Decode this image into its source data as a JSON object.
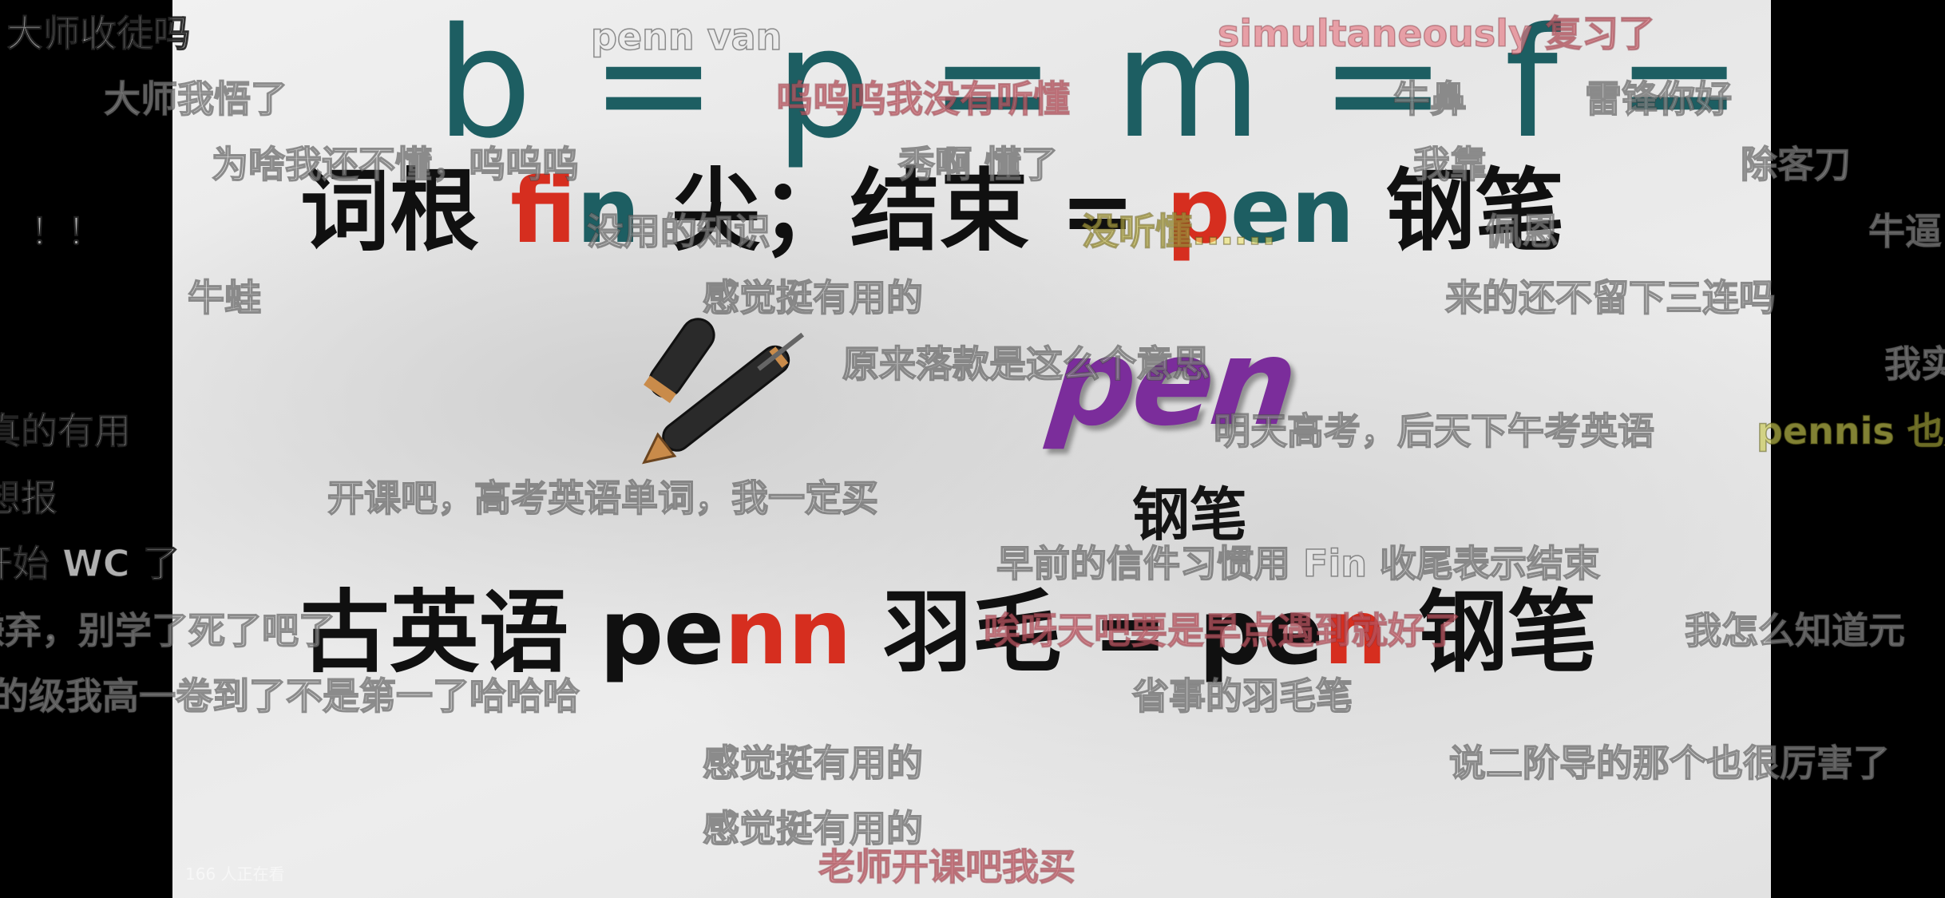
{
  "slide": {
    "formula": "b = p = m = f = v",
    "line2": {
      "prefix": "词根 ",
      "f": "f",
      "in": "in",
      "mid": " 尖；结束 = ",
      "p": "p",
      "en": "en",
      "suffix": " 钢笔"
    },
    "logo_text": "pen",
    "pen_caption": "钢笔",
    "line3": {
      "prefix": "古英语 pe",
      "nn": "nn",
      "mid": " 羽毛 = pe",
      "n": "n",
      "suffix": " 钢笔"
    }
  },
  "danmaku": [
    {
      "text": "大师收徒吗",
      "style": "dark"
    },
    {
      "text": "penn    van",
      "style": "normal"
    },
    {
      "text": "simultaneously 复习了",
      "style": "pink"
    },
    {
      "text": "大师我悟了",
      "style": "normal"
    },
    {
      "text": "呜呜呜我没有听懂",
      "style": "pink"
    },
    {
      "text": "牛鼻",
      "style": "normal"
    },
    {
      "text": "雷锋你好",
      "style": "normal"
    },
    {
      "text": "为啥我还不懂，呜呜呜",
      "style": "normal"
    },
    {
      "text": "秀啊 懂了",
      "style": "normal"
    },
    {
      "text": "我靠",
      "style": "normal"
    },
    {
      "text": "除客刀",
      "style": "normal"
    },
    {
      "text": "！！",
      "style": "dark"
    },
    {
      "text": "没用的知识",
      "style": "normal"
    },
    {
      "text": "没听懂......",
      "style": "yellow"
    },
    {
      "text": "佩恩",
      "style": "normal"
    },
    {
      "text": "牛逼",
      "style": "normal"
    },
    {
      "text": "牛蛙",
      "style": "normal"
    },
    {
      "text": "感觉挺有用的",
      "style": "normal"
    },
    {
      "text": "来的还不留下三连吗",
      "style": "normal"
    },
    {
      "text": "原来落款是这么个意思",
      "style": "normal"
    },
    {
      "text": "我实",
      "style": "normal"
    },
    {
      "text": "真的有用",
      "style": "dark"
    },
    {
      "text": "明天高考，后天下午考英语",
      "style": "normal"
    },
    {
      "text": "pennis 也是",
      "style": "olive"
    },
    {
      "text": "想报",
      "style": "dark"
    },
    {
      "text": "开课吧，高考英语单词，我一定买",
      "style": "normal"
    },
    {
      "text": "开始 WC 了",
      "style": "dark"
    },
    {
      "text": "早前的信件习惯用 Fin 收尾表示结束",
      "style": "normal"
    },
    {
      "text": "嫌弃，别学了死了吧了",
      "style": "normal"
    },
    {
      "text": "唉呀天吧要是早点遇到就好了",
      "style": "pink"
    },
    {
      "text": "我怎么知道元",
      "style": "normal"
    },
    {
      "text": "的级我高一卷到了不是第一了哈哈哈",
      "style": "normal"
    },
    {
      "text": "省事的羽毛笔",
      "style": "normal"
    },
    {
      "text": "感觉挺有用的",
      "style": "normal"
    },
    {
      "text": "说二阶导的那个也很厉害了",
      "style": "normal"
    },
    {
      "text": "感觉挺有用的",
      "style": "normal"
    },
    {
      "text": "老师开课吧我买",
      "style": "pink"
    }
  ],
  "viewer_count": "166 人正在看",
  "colors": {
    "formula": "#1d5e62",
    "accent_red": "#d62e1f",
    "logo_purple": "#7b2d9b",
    "letterbox": "#000000"
  },
  "icons": [
    "fountain-pen-icon"
  ]
}
